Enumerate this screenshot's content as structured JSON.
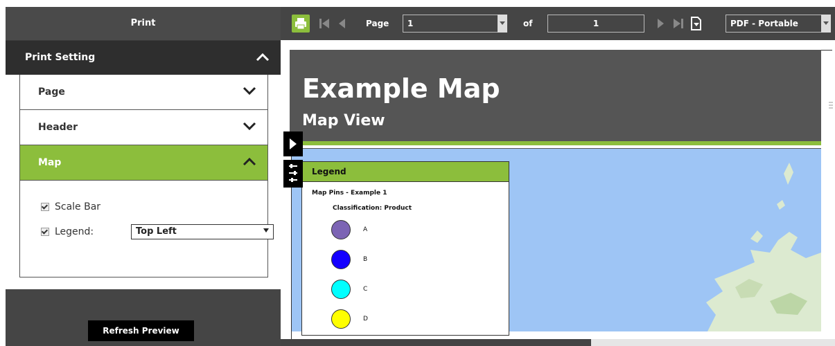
{
  "panel": {
    "title": "Print",
    "print_setting_label": "Print Setting",
    "sections": [
      {
        "label": "Page",
        "expanded": false
      },
      {
        "label": "Header",
        "expanded": false
      },
      {
        "label": "Map",
        "expanded": true
      }
    ],
    "options": {
      "scale_bar_label": "Scale Bar",
      "scale_bar_checked": true,
      "legend_label": "Legend:",
      "legend_checked": true,
      "legend_position_value": "Top Left"
    },
    "refresh_button": "Refresh Preview"
  },
  "toolbar": {
    "page_label": "Page",
    "page_value": "1",
    "of_label": "of",
    "total_pages": "1",
    "format_value": "PDF - Portable"
  },
  "preview": {
    "map_title": "Example Map",
    "map_subtitle": "Map View",
    "legend": {
      "heading": "Legend",
      "layer_title": "Map Pins - Example 1",
      "classification": "Classification: Product",
      "items": [
        {
          "label": "A",
          "color": "#7c64b4"
        },
        {
          "label": "B",
          "color": "#1400ff"
        },
        {
          "label": "C",
          "color": "#00ffff"
        },
        {
          "label": "D",
          "color": "#ffff00"
        }
      ]
    }
  },
  "colors": {
    "accent": "#8cbe3c",
    "panel_bg": "#454545",
    "header_bg": "#555555",
    "map_water": "#9ec5f5"
  }
}
